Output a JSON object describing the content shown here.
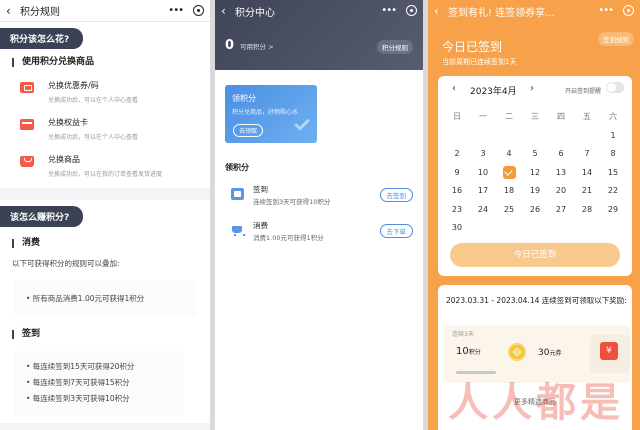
{
  "p1": {
    "nav_title": "积分规则",
    "section_spend": "积分该怎么花?",
    "redeem_heading": "使用积分兑换商品",
    "redeem_items": [
      {
        "name": "兑换优惠券/码",
        "desc": "兑换成功后，可以在个人中心查看"
      },
      {
        "name": "兑换权益卡",
        "desc": "兑换成功后，可以在个人中心查看"
      },
      {
        "name": "兑换商品",
        "desc": "兑换成功后，可以在我的订单查看发货进度"
      }
    ],
    "section_earn": "该怎么赚积分?",
    "spend_heading": "消费",
    "spend_note": "以下可获得积分的规则可以叠加:",
    "spend_rule": "• 所有商品消费1.00元可获得1积分",
    "sign_heading": "签到",
    "sign_rules": [
      "• 每连续签到15天可获得20积分",
      "• 每连续签到7天可获得15积分",
      "• 每连续签到3天可获得10积分"
    ]
  },
  "p2": {
    "nav_title": "积分中心",
    "points_value": "0",
    "points_label": "可用积分 >",
    "rules_button": "积分规则",
    "banner_title": "领积分",
    "banner_desc": "积分兑商品，好物购心水",
    "banner_button": "去领取",
    "earn_title": "领积分",
    "tasks": [
      {
        "name": "签到",
        "desc": "连续签到3天可获得10积分",
        "button": "去签到"
      },
      {
        "name": "消费",
        "desc": "消费1.00元可获得1积分",
        "button": "去下单"
      }
    ]
  },
  "p3": {
    "nav_title": "签到有礼! 连签领券享...",
    "today_title": "今日已签到",
    "today_sub": "当前周期已连续签到1天",
    "rules_button": "签到规则",
    "month": "2023年4月",
    "remind_label": "开启签到提醒",
    "weekdays": [
      "日",
      "一",
      "二",
      "三",
      "四",
      "五",
      "六"
    ],
    "days": [
      "",
      "",
      "",
      "",
      "",
      "",
      "1",
      "2",
      "3",
      "4",
      "5",
      "6",
      "7",
      "8",
      "9",
      "10",
      "11",
      "12",
      "13",
      "14",
      "15",
      "16",
      "17",
      "18",
      "19",
      "20",
      "21",
      "22",
      "23",
      "24",
      "25",
      "26",
      "27",
      "28",
      "29",
      "30",
      "",
      "",
      "",
      "",
      "",
      ""
    ],
    "checked_day": "11",
    "signed_button": "今日已签到",
    "reward_title": "2023.03.31 - 2023.04.14 连续签到可领取以下奖励:",
    "reward_days": "连续3天",
    "reward_points": "10",
    "reward_points_unit": "积分",
    "reward_coupon": "30",
    "reward_coupon_unit": "元券",
    "rmb_symbol": "¥",
    "more_title": "更多精选商品",
    "watermark": "人人都是"
  },
  "colors": {
    "dark_navy": "#3b4255",
    "accent_blue": "#4a8fe2",
    "orange": "#f7a24a",
    "check_orange": "#f39a3a",
    "red": "#f15b48"
  }
}
